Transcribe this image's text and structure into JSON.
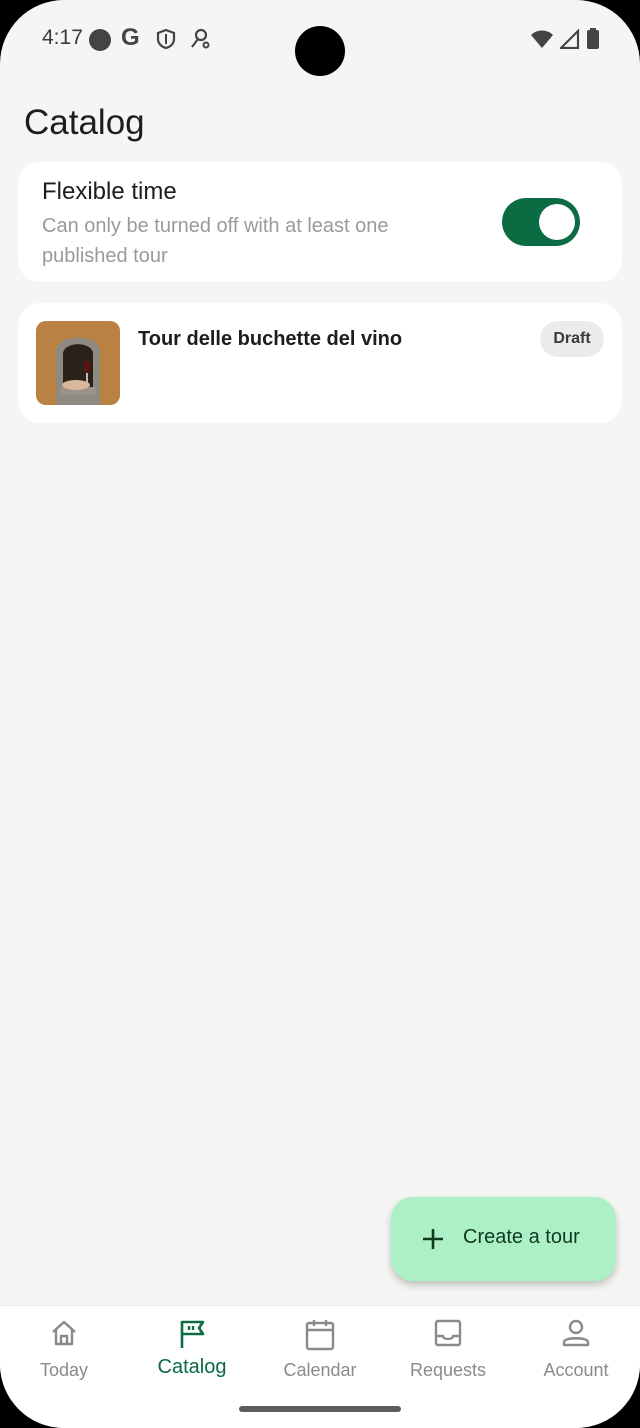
{
  "status_bar": {
    "time": "4:17",
    "google_letter": "G",
    "left_icons": [
      "dot-icon",
      "google-icon",
      "shield-icon",
      "key-icon"
    ],
    "right_icons": [
      "wifi-icon",
      "signal-icon",
      "battery-icon"
    ]
  },
  "header": {
    "title": "Catalog"
  },
  "flexible_time": {
    "title": "Flexible time",
    "subtitle": "Can only be turned off with at least one published tour",
    "toggle_on": true
  },
  "tours": [
    {
      "name": "Tour delle buchette del vino",
      "status": "Draft"
    }
  ],
  "fab": {
    "label": "Create a tour",
    "icon": "plus-icon"
  },
  "nav": {
    "items": [
      {
        "label": "Today",
        "icon": "home-icon"
      },
      {
        "label": "Catalog",
        "icon": "flag-icon",
        "active": true
      },
      {
        "label": "Calendar",
        "icon": "calendar-icon"
      },
      {
        "label": "Requests",
        "icon": "inbox-icon"
      },
      {
        "label": "Account",
        "icon": "person-icon"
      }
    ]
  },
  "colors": {
    "accent": "#0b6b43",
    "fab_background": "#aef0c6",
    "page_background": "#f5f5f3"
  }
}
